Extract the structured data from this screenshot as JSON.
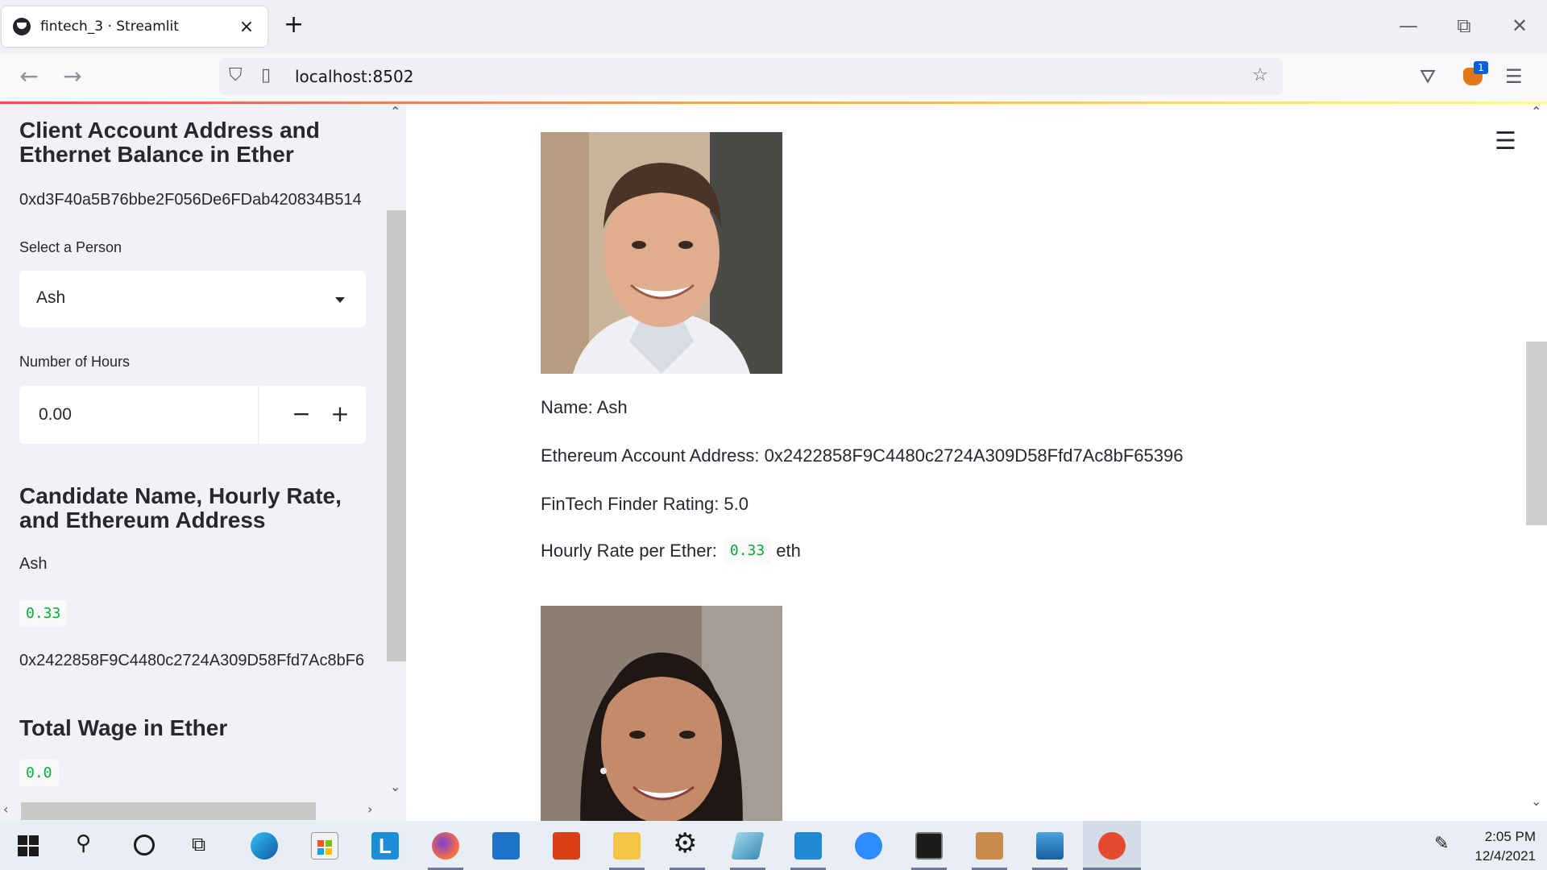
{
  "browser": {
    "tab_title": "fintech_3 · Streamlit",
    "tab_close": "×",
    "new_tab": "+",
    "url": "localhost:8502",
    "window_controls": {
      "minimize": "—",
      "restore": "⧉",
      "close": "✕"
    },
    "extension_badge": "1"
  },
  "sidebar": {
    "account_heading": "Client Account Address and Ethernet Balance in Ether",
    "account_address": "0xd3F40a5B76bbe2F056De6FDab420834B514",
    "select_label": "Select a Person",
    "selected_person": "Ash",
    "hours_label": "Number of Hours",
    "hours_value": "0.00",
    "minus": "−",
    "plus": "+",
    "candidate_heading": "Candidate Name, Hourly Rate, and Ethereum Address",
    "candidate_name": "Ash",
    "candidate_rate": "0.33",
    "candidate_address": "0x2422858F9C4480c2724A309D58Ffd7Ac8bF6",
    "wage_heading": "Total Wage in Ether",
    "wage_value": "0.0"
  },
  "main": {
    "name_line": "Name: Ash",
    "address_line": "Ethereum Account Address: 0x2422858F9C4480c2724A309D58Ffd7Ac8bF65396",
    "rating_line": "FinTech Finder Rating: 5.0",
    "rate_prefix": "Hourly Rate per Ether:",
    "rate_value": "0.33",
    "rate_suffix": "eth"
  },
  "taskbar": {
    "time": "2:05 PM",
    "date": "12/4/2021",
    "app_letter": "L"
  },
  "colors": {
    "accent_red": "#ff4b4b",
    "code_green": "#09ab3b",
    "sidebar_bg": "#f0f2f6"
  }
}
